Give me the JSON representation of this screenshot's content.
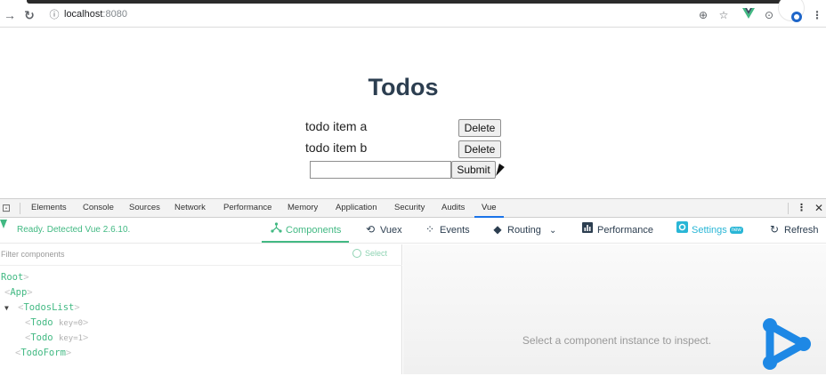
{
  "browser": {
    "url_host": "localhost",
    "url_port": ":8080"
  },
  "page": {
    "title": "Todos",
    "todos": [
      {
        "text": "todo item a",
        "delete_label": "Delete"
      },
      {
        "text": "todo item b",
        "delete_label": "Delete"
      }
    ],
    "input_value": "",
    "submit_label": "Submit"
  },
  "devtools": {
    "tabs": [
      "Elements",
      "Console",
      "Sources",
      "Network",
      "Performance",
      "Memory",
      "Application",
      "Security",
      "Audits",
      "Vue"
    ],
    "active_tab": "Vue"
  },
  "vue": {
    "status": "Ready. Detected Vue 2.6.10.",
    "nav": {
      "components": "Components",
      "vuex": "Vuex",
      "events": "Events",
      "routing": "Routing",
      "performance": "Performance",
      "settings": "Settings",
      "settings_badge": "new",
      "refresh": "Refresh"
    },
    "filter_placeholder": "Filter components",
    "select_label": "Select",
    "tree": {
      "root": "Root",
      "app": "App",
      "todos_list": "TodosList",
      "todo": "Todo",
      "todo_key_0": "key=0",
      "todo_key_1": "key=1",
      "todo_form": "TodoForm"
    },
    "inspect_message": "Select a component instance to inspect."
  },
  "colors": {
    "vue_green": "#42b983",
    "settings_blue": "#29b6d6",
    "title_color": "#2c3e50",
    "logo_blue": "#1e88e5"
  }
}
